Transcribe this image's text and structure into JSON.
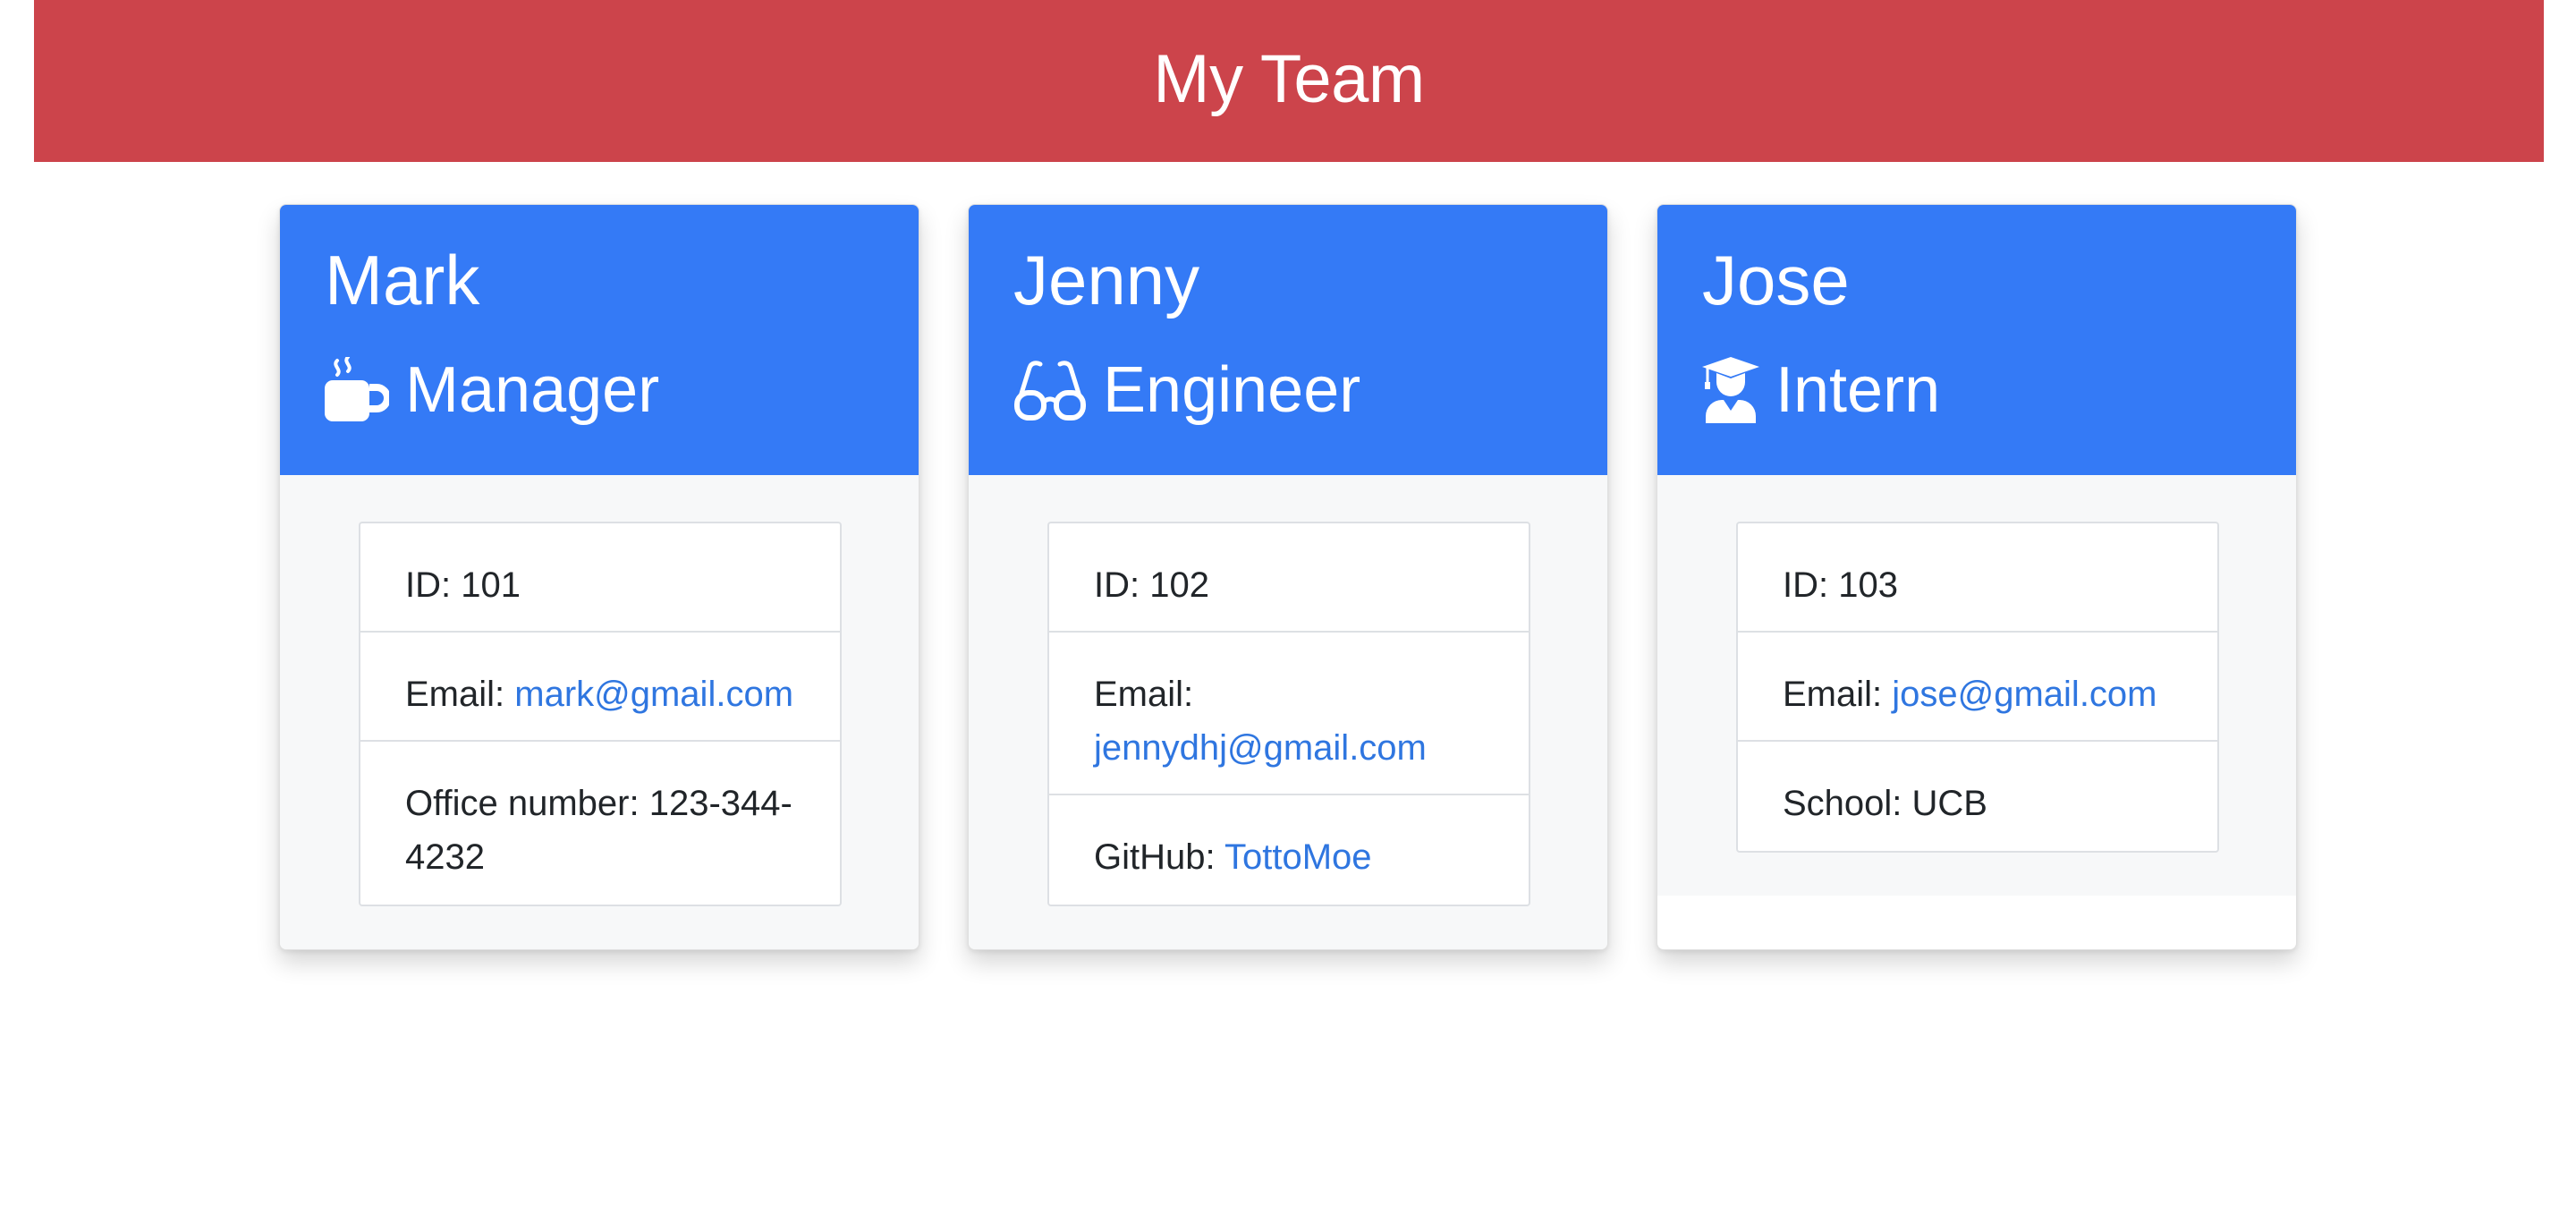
{
  "header": {
    "title": "My Team"
  },
  "team": [
    {
      "name": "Mark",
      "role": "Manager",
      "role_icon": "mug-hot-icon",
      "id_label": "ID: 101",
      "email_label": "Email: ",
      "email": "mark@gmail.com",
      "extra_label": "Office number: ",
      "extra_value": "123-344-4232"
    },
    {
      "name": "Jenny",
      "role": "Engineer",
      "role_icon": "glasses-icon",
      "id_label": "ID: 102",
      "email_label": "Email: ",
      "email": "jennydhj@gmail.com",
      "extra_label": "GitHub: ",
      "extra_value": "TottoMoe"
    },
    {
      "name": "Jose",
      "role": "Intern",
      "role_icon": "user-graduate-icon",
      "id_label": "ID: 103",
      "email_label": "Email: ",
      "email": "jose@gmail.com",
      "extra_label": "School: ",
      "extra_value": "UCB"
    }
  ],
  "colors": {
    "header_bg": "#cc444b",
    "card_header_bg": "#347af6",
    "link": "#2f76e0",
    "card_body_bg": "#f7f8f9"
  }
}
